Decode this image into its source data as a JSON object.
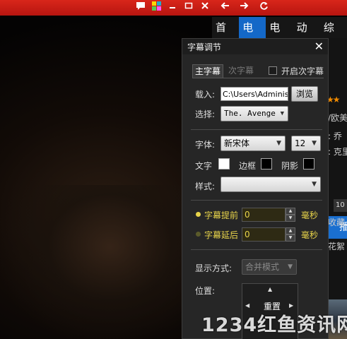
{
  "window": {
    "controls": [
      "message-icon",
      "skin-icon",
      "minimize-icon",
      "maximize-icon",
      "close-icon",
      "back-icon",
      "forward-icon",
      "refresh-icon"
    ]
  },
  "nav": {
    "items": [
      {
        "label": "首页",
        "active": false
      },
      {
        "label": "电影",
        "active": true
      },
      {
        "label": "电视",
        "active": false
      },
      {
        "label": "动漫",
        "active": false
      },
      {
        "label": "综艺",
        "active": false
      }
    ]
  },
  "right_page": {
    "stars": "★★",
    "texts": [
      "/欧美",
      ": 乔",
      ": 克里",
      "收藏",
      "花絮"
    ],
    "tag": "10",
    "play_label": "播"
  },
  "dialog": {
    "title": "字幕调节",
    "tabs": {
      "primary": "主字幕",
      "secondary": "次字幕"
    },
    "enable_secondary": {
      "label": "开启次字幕",
      "checked": false
    },
    "load": {
      "label": "载入:",
      "path": "C:\\Users\\Administra",
      "browse": "浏览"
    },
    "select": {
      "label": "选择:",
      "value": "The. Avenge"
    },
    "font": {
      "label": "字体:",
      "family": "新宋体",
      "size": "12"
    },
    "colors": {
      "text_label": "文字",
      "border_label": "边框",
      "shadow_label": "阴影"
    },
    "style": {
      "label": "样式:",
      "value": ""
    },
    "advance": {
      "label": "字幕提前",
      "value": "0",
      "unit": "毫秒",
      "dot_color": "#e8d44a"
    },
    "delay": {
      "label": "字幕延后",
      "value": "0",
      "unit": "毫秒",
      "dot_color": "#5a5a2a"
    },
    "display_mode": {
      "label": "显示方式:",
      "value": "合并模式"
    },
    "position": {
      "label": "位置:",
      "reset": "重置"
    }
  },
  "watermark": "1234红鱼资讯网",
  "accent": "#1468c8",
  "titlebar_color": "#c81e14"
}
